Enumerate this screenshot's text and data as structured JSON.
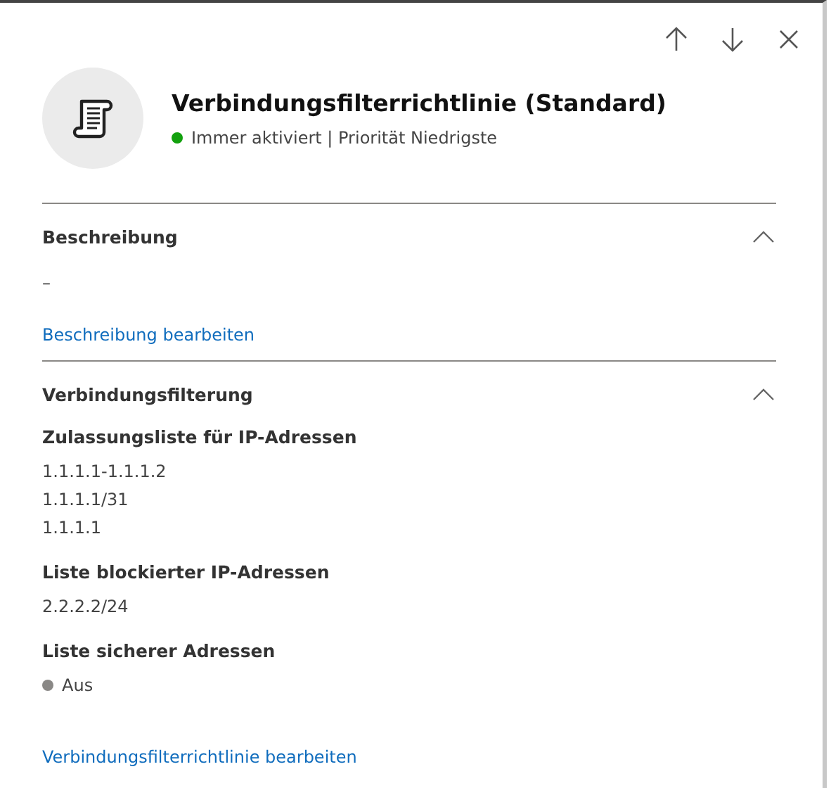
{
  "header": {
    "title": "Verbindungsfilterrichtlinie (Standard)",
    "status": {
      "text": "Immer aktiviert | Priorität Niedrigste",
      "color": "#13a10e"
    }
  },
  "sections": [
    {
      "title": "Beschreibung",
      "expanded": true,
      "groups": [
        {
          "values": [
            {
              "text": "–"
            }
          ]
        }
      ],
      "link": "Beschreibung bearbeiten"
    },
    {
      "title": "Verbindungsfilterung",
      "expanded": true,
      "groups": [
        {
          "label": "Zulassungsliste für IP-Adressen",
          "values": [
            {
              "text": "1.1.1.1-1.1.1.2"
            },
            {
              "text": "1.1.1.1/31"
            },
            {
              "text": "1.1.1.1"
            }
          ]
        },
        {
          "label": "Liste blockierter IP-Adressen",
          "values": [
            {
              "text": "2.2.2.2/24"
            }
          ]
        },
        {
          "label": "Liste sicherer Adressen",
          "values": [
            {
              "text": "Aus",
              "color": "#8a8886"
            }
          ]
        }
      ],
      "link": "Verbindungsfilterrichtlinie bearbeiten"
    }
  ]
}
